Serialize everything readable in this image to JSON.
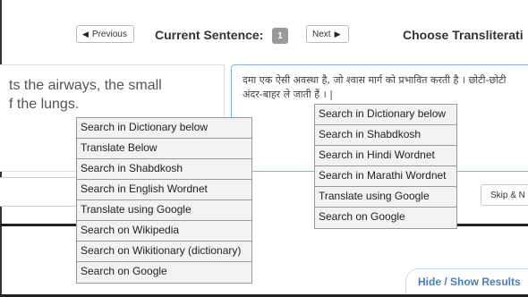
{
  "toolbar": {
    "previous_label": "Previous",
    "previous_icon": "caret-left-icon",
    "current_sentence_label": "Current Sentence:",
    "current_sentence_number": "1",
    "next_label": "Next",
    "next_icon": "caret-right-icon",
    "choose_label": "Choose Transliterati"
  },
  "source_pane": {
    "text_lines": [
      "ts the airways, the small",
      "f the lungs."
    ]
  },
  "target_pane": {
    "text_lines": [
      "दमा एक ऐसी अवस्था है, जो श्वास मार्ग को प्रभावित करती है । छोटी-छोटी",
      "अंदर-बाहर ले जाती हैं । |"
    ]
  },
  "left_menu": {
    "items": [
      "Search in Dictionary below",
      "Translate Below",
      "Search in Shabdkosh",
      "Search in English Wordnet",
      "Translate using Google",
      "Search on Wikipedia",
      "Search on Wikitionary (dictionary)",
      "Search on Google"
    ]
  },
  "right_menu": {
    "items": [
      "Search in Dictionary below",
      "Search in Shabdkosh",
      "Search in Hindi Wordnet",
      "Search in Marathi Wordnet",
      "Translate using Google",
      "Search on Google"
    ]
  },
  "controls": {
    "skip_label": "Skip & N",
    "hide_show_label": "Hide / Show Results"
  },
  "colors": {
    "badge": "#999999",
    "link_blue": "#4a7fb5",
    "menu_bg": "#f2f2f2"
  }
}
